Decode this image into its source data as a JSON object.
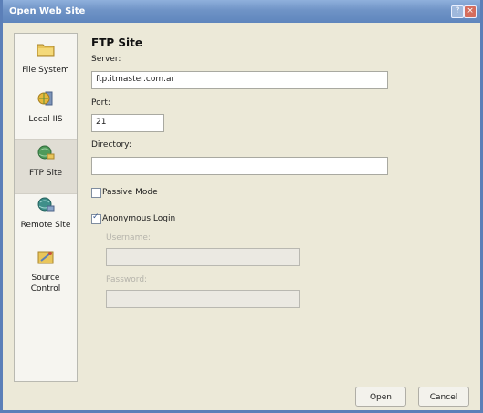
{
  "window": {
    "title": "Open Web Site"
  },
  "titlebar_buttons": {
    "help": "?",
    "close": "×"
  },
  "sidebar": {
    "items": [
      {
        "label": "File System",
        "icon": "folder-icon"
      },
      {
        "label": "Local IIS",
        "icon": "local-iis-icon"
      },
      {
        "label": "FTP Site",
        "icon": "ftp-site-icon",
        "selected": true
      },
      {
        "label": "Remote Site",
        "icon": "remote-site-icon"
      },
      {
        "label": "Source Control",
        "icon": "source-control-icon"
      }
    ]
  },
  "main": {
    "heading": "FTP Site",
    "server": {
      "label": "Server:",
      "value": "ftp.itmaster.com.ar"
    },
    "port": {
      "label": "Port:",
      "value": "21"
    },
    "directory": {
      "label": "Directory:",
      "value": ""
    },
    "passive_mode": {
      "label": "Passive Mode",
      "checked": false
    },
    "anonymous_login": {
      "label": "Anonymous Login",
      "checked": true
    },
    "username": {
      "label": "Username:",
      "value": ""
    },
    "password": {
      "label": "Password:",
      "value": ""
    }
  },
  "buttons": {
    "open": "Open",
    "cancel": "Cancel"
  },
  "colors": {
    "titlebar": "#6f93c6",
    "dialog_bg": "#ece9d8",
    "close_button": "#d46d5d"
  }
}
